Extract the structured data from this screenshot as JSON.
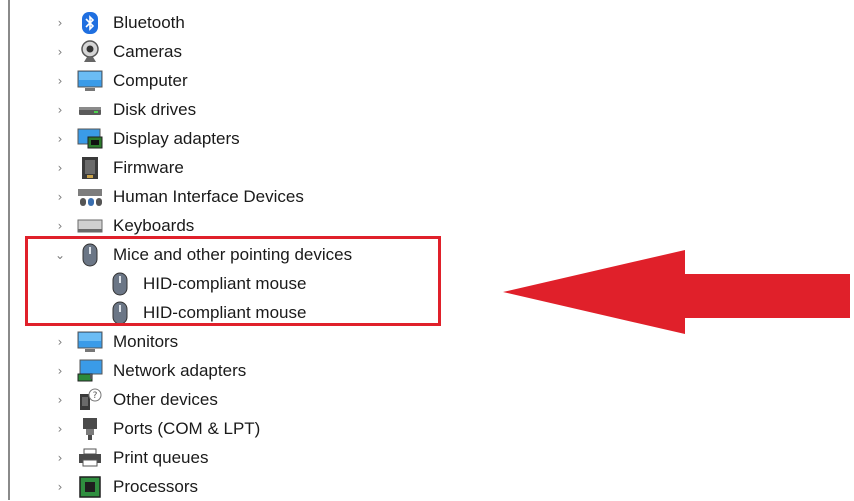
{
  "tree": {
    "categories": [
      {
        "label": "Bluetooth",
        "icon": "bluetooth-icon",
        "expanded": false
      },
      {
        "label": "Cameras",
        "icon": "camera-icon",
        "expanded": false
      },
      {
        "label": "Computer",
        "icon": "computer-icon",
        "expanded": false
      },
      {
        "label": "Disk drives",
        "icon": "disk-drive-icon",
        "expanded": false
      },
      {
        "label": "Display adapters",
        "icon": "display-adapter-icon",
        "expanded": false
      },
      {
        "label": "Firmware",
        "icon": "firmware-icon",
        "expanded": false
      },
      {
        "label": "Human Interface Devices",
        "icon": "hid-icon",
        "expanded": false
      },
      {
        "label": "Keyboards",
        "icon": "keyboard-icon",
        "expanded": false
      },
      {
        "label": "Mice and other pointing devices",
        "icon": "mouse-icon",
        "expanded": true,
        "children": [
          {
            "label": "HID-compliant mouse",
            "icon": "mouse-icon"
          },
          {
            "label": "HID-compliant mouse",
            "icon": "mouse-icon"
          }
        ]
      },
      {
        "label": "Monitors",
        "icon": "monitor-icon",
        "expanded": false
      },
      {
        "label": "Network adapters",
        "icon": "network-adapter-icon",
        "expanded": false
      },
      {
        "label": "Other devices",
        "icon": "other-devices-icon",
        "expanded": false
      },
      {
        "label": "Ports (COM & LPT)",
        "icon": "port-icon",
        "expanded": false
      },
      {
        "label": "Print queues",
        "icon": "printer-icon",
        "expanded": false
      },
      {
        "label": "Processors",
        "icon": "processor-icon",
        "expanded": false
      }
    ],
    "chevron_collapsed": "›",
    "chevron_expanded": "⌄"
  },
  "annotation": {
    "highlight_color": "#e0202a",
    "arrow_color": "#e0202a"
  }
}
